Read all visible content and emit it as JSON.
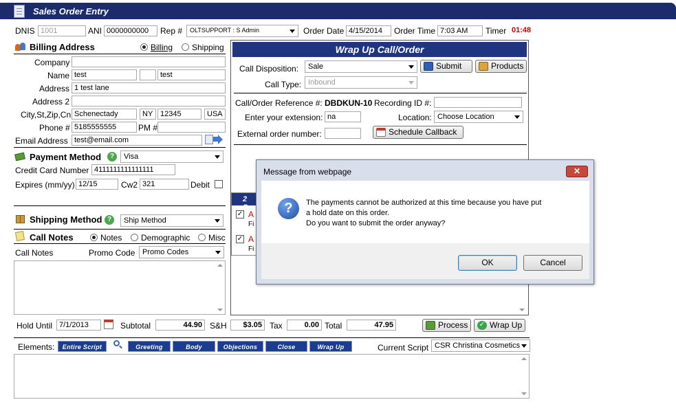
{
  "window": {
    "title": "Sales Order Entry"
  },
  "top": {
    "dnis_label": "DNIS",
    "dnis_value": "1001",
    "ani_label": "ANI",
    "ani_value": "0000000000",
    "rep_label": "Rep #",
    "rep_value": "OLTSUPPORT : S Admin",
    "order_date_label": "Order Date",
    "order_date_value": "4/15/2014",
    "order_time_label": "Order Time",
    "order_time_value": "7:03 AM",
    "timer_label": "Timer",
    "timer_value": "01:48"
  },
  "billing": {
    "title": "Billing Address",
    "radio_billing": "Billing",
    "radio_shipping": "Shipping",
    "company_label": "Company",
    "company_value": "",
    "name_label": "Name",
    "first_name": "test",
    "mi": "",
    "last_name": "test",
    "address_label": "Address",
    "address_value": "1 test lane",
    "address2_label": "Address 2",
    "address2_value": "",
    "city_label": "City,St,Zip,Cn",
    "city": "Schenectady",
    "state": "NY",
    "zip": "12345",
    "country": "USA",
    "phone_label": "Phone #",
    "phone_value": "5185555555",
    "pm_label": "PM #",
    "pm_value": "",
    "email_label": "Email Address",
    "email_value": "test@email.com"
  },
  "payment": {
    "title": "Payment Method",
    "method": "Visa",
    "cc_label": "Credit Card Number",
    "cc_value": "4111111111111111",
    "expires_label": "Expires (mm/yy)",
    "expires_value": "12/15",
    "cvv_label": "Cw2",
    "cvv_value": "321",
    "debit_label": "Debit"
  },
  "shipping": {
    "title": "Shipping Method",
    "method": "Ship Method"
  },
  "notes": {
    "title": "Call Notes",
    "radio_notes": "Notes",
    "radio_demo": "Demographic",
    "radio_misc": "Misc",
    "call_notes_label": "Call Notes",
    "promo_label": "Promo Code",
    "promo_value": "Promo Codes"
  },
  "wrapup": {
    "title": "Wrap Up Call/Order",
    "disposition_label": "Call Disposition:",
    "disposition_value": "Sale",
    "submit_label": "Submit",
    "products_label": "Products",
    "call_type_label": "Call Type:",
    "call_type_value": "Inbound",
    "ref_label": "Call/Order Reference #:",
    "ref_value": "DBDKUN-10",
    "recording_label": "Recording ID #:",
    "recording_value": "",
    "extension_label": "Enter your extension:",
    "extension_value": "na",
    "location_label": "Location:",
    "location_value": "Choose Location",
    "external_label": "External order number:",
    "external_value": "",
    "callback_label": "Schedule Callback",
    "list_header": "2 Sc",
    "item1_text": "A",
    "item1_sub": "Fi",
    "item2_text": "A",
    "item2_sub": "Fi"
  },
  "totals": {
    "hold_label": "Hold Until",
    "hold_value": "7/1/2013",
    "subtotal_label": "Subtotal",
    "subtotal_value": "44.90",
    "sh_label": "S&H",
    "sh_value": "$3.05",
    "tax_label": "Tax",
    "tax_value": "0.00",
    "total_label": "Total",
    "total_value": "47.95",
    "process_label": "Process",
    "wrapup_label": "Wrap Up"
  },
  "script": {
    "elements_label": "Elements:",
    "segments": [
      "Entire Script",
      "Greeting",
      "Body",
      "Objections",
      "Close",
      "Wrap Up"
    ],
    "current_label": "Current Script",
    "current_value": "CSR Christina Cosmetics"
  },
  "dialog": {
    "title": "Message from webpage",
    "line1": "The payments cannot be authorized at this time because you have put",
    "line2": "a hold date on this order.",
    "line3": "Do you want to submit the order anyway?",
    "ok_label": "OK",
    "cancel_label": "Cancel"
  },
  "colors": {
    "title_bar": "#1b2b6b",
    "wrapup_header": "#1f3580",
    "segment_bg": "#1a3d8f",
    "timer": "#cc0000",
    "dialog_close": "#c9473b"
  }
}
